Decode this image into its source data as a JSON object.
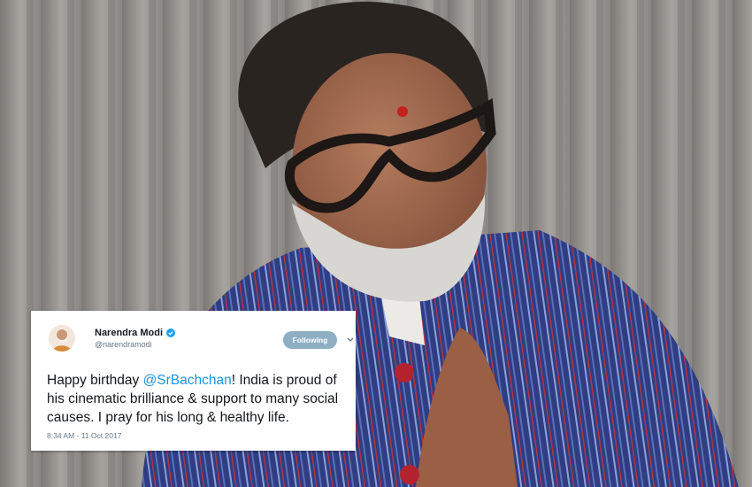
{
  "tweet": {
    "author_name": "Narendra Modi",
    "author_handle": "@narendramodi",
    "follow_label": "Following",
    "text_before_mention": "Happy birthday ",
    "mention": "@SrBachchan",
    "text_after_mention": "! India is proud of his cinematic brilliance & support to many social causes. I pray for his long & healthy life.",
    "timestamp": "8:34 AM - 11 Oct 2017"
  },
  "colors": {
    "mention": "#1b95e0",
    "follow_button": "#8eaec4",
    "verified": "#1da1f2"
  },
  "icons": [
    "verified-icon",
    "chevron-down-icon"
  ]
}
